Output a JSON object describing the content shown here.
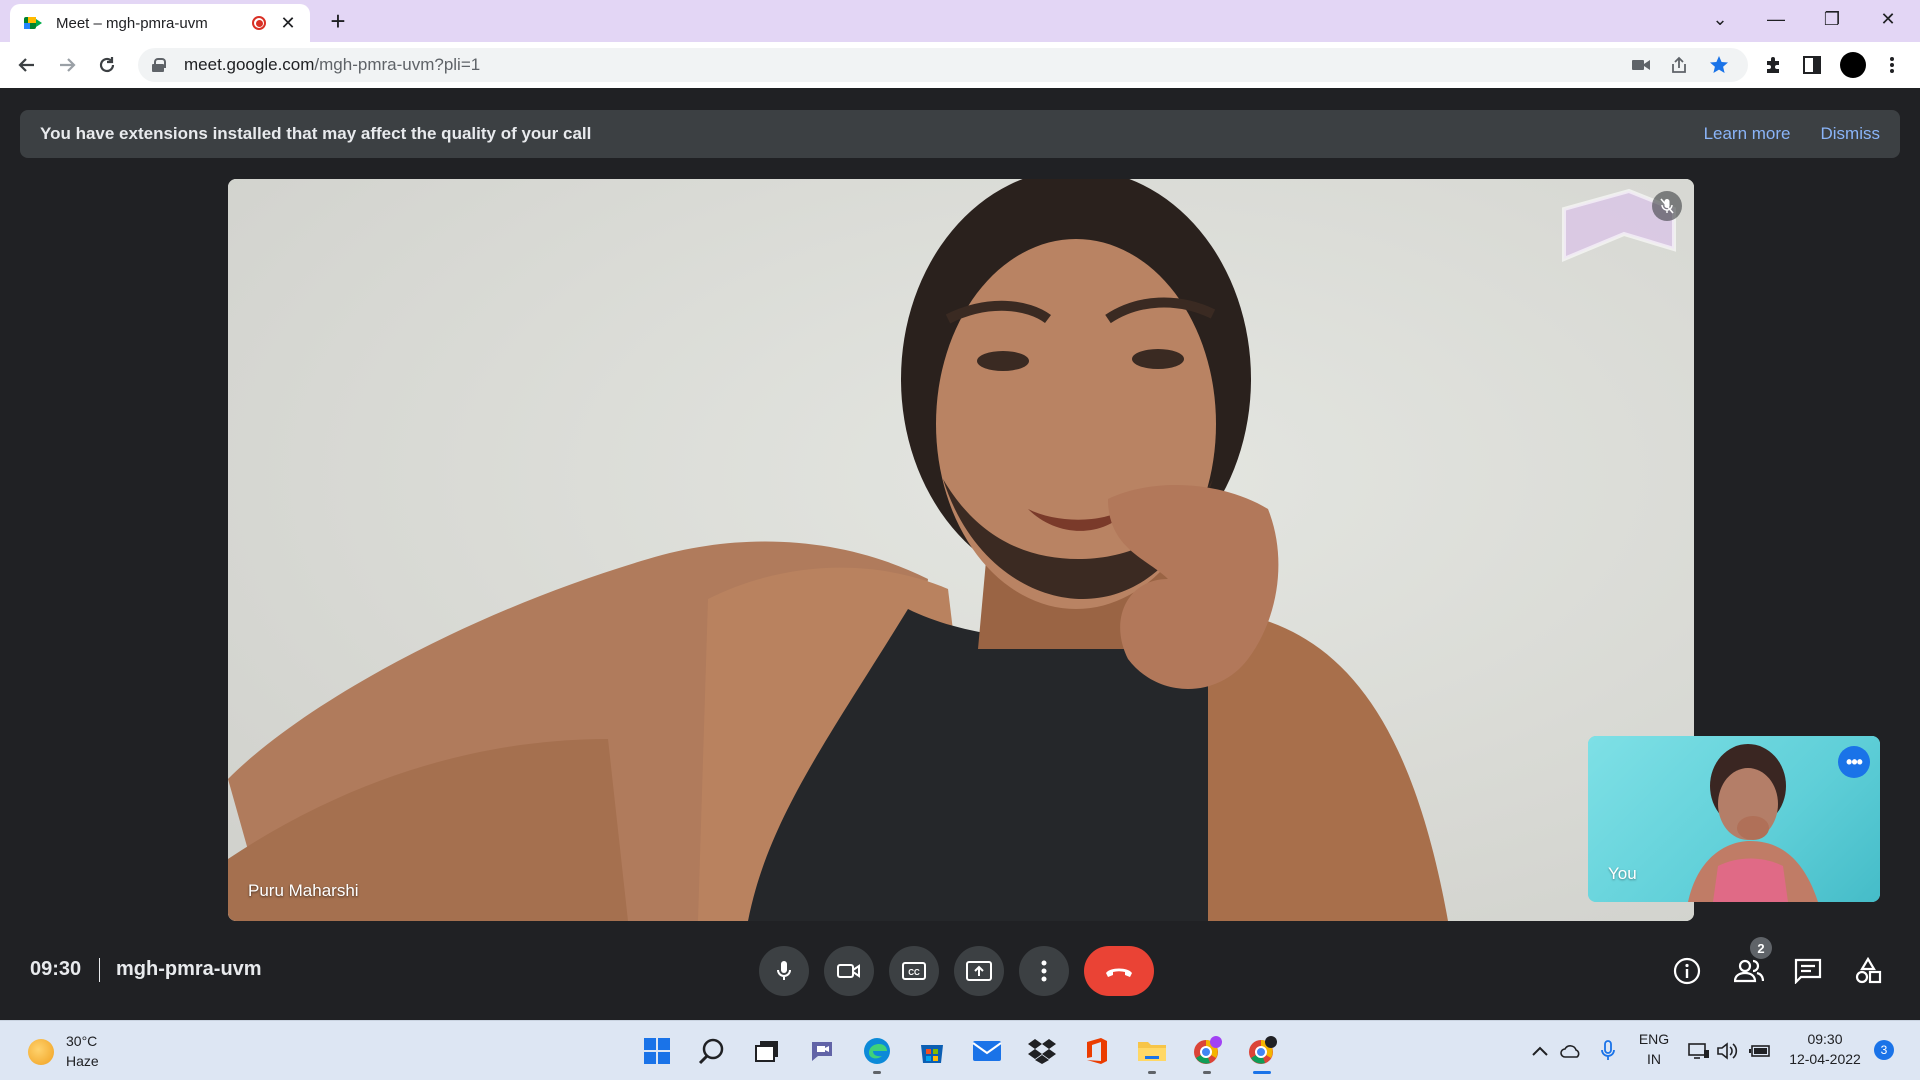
{
  "browser": {
    "tab_title": "Meet – mgh-pmra-uvm",
    "tab_close": "✕",
    "new_tab": "+",
    "url_host": "meet.google.com",
    "url_path": "/mgh-pmra-uvm?pli=1",
    "window_controls": {
      "dropdown": "⌄",
      "minimize": "—",
      "restore": "❐",
      "close": "✕"
    }
  },
  "banner": {
    "text": "You have extensions installed that may affect the quality of your call",
    "learn_more": "Learn more",
    "dismiss": "Dismiss"
  },
  "main_participant": {
    "name": "Puru Maharshi",
    "muted": true
  },
  "self_view": {
    "name": "You",
    "more": "•••"
  },
  "meeting": {
    "time": "09:30",
    "code": "mgh-pmra-uvm"
  },
  "controls": [
    "microphone",
    "camera",
    "captions",
    "present-now",
    "more-options",
    "leave-call"
  ],
  "right_controls": {
    "people_count": "2"
  },
  "taskbar": {
    "weather_temp": "30°C",
    "weather_desc": "Haze",
    "lang_top": "ENG",
    "lang_bottom": "IN",
    "clock_time": "09:30",
    "clock_date": "12-04-2022",
    "notifications": "3"
  },
  "colors": {
    "accent": "#1a73e8",
    "end_call": "#ea4335",
    "banner_bg": "#3c4043",
    "meet_bg": "#202124",
    "tab_strip": "#e3d6f5"
  }
}
